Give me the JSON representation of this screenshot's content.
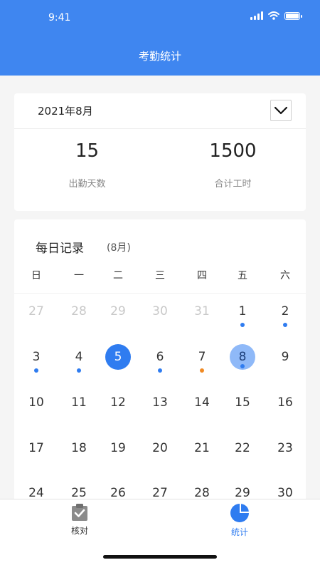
{
  "status": {
    "time": "9:41"
  },
  "nav": {
    "title": "考勤统计"
  },
  "summary": {
    "month": "2021年8月",
    "stats": [
      {
        "value": "15",
        "label": "出勤天数"
      },
      {
        "value": "1500",
        "label": "合计工时"
      }
    ]
  },
  "calendar": {
    "title": "每日记录",
    "subtitle": "(8月)",
    "weekdays": [
      "日",
      "一",
      "二",
      "三",
      "四",
      "五",
      "六"
    ],
    "dot_colors": {
      "blue": "#2f7cf0",
      "orange": "#f08a24"
    },
    "weeks": [
      [
        {
          "day": "27",
          "other": true
        },
        {
          "day": "28",
          "other": true
        },
        {
          "day": "29",
          "other": true
        },
        {
          "day": "30",
          "other": true
        },
        {
          "day": "31",
          "other": true
        },
        {
          "day": "1",
          "dot": "blue"
        },
        {
          "day": "2",
          "dot": "blue"
        }
      ],
      [
        {
          "day": "3",
          "dot": "blue"
        },
        {
          "day": "4",
          "dot": "blue"
        },
        {
          "day": "5",
          "state": "today"
        },
        {
          "day": "6",
          "dot": "blue"
        },
        {
          "day": "7",
          "dot": "orange"
        },
        {
          "day": "8",
          "state": "selected",
          "dot": "blue"
        },
        {
          "day": "9"
        }
      ],
      [
        {
          "day": "10"
        },
        {
          "day": "11"
        },
        {
          "day": "12"
        },
        {
          "day": "13"
        },
        {
          "day": "14"
        },
        {
          "day": "15"
        },
        {
          "day": "16"
        }
      ],
      [
        {
          "day": "17"
        },
        {
          "day": "18"
        },
        {
          "day": "19"
        },
        {
          "day": "20"
        },
        {
          "day": "21"
        },
        {
          "day": "22"
        },
        {
          "day": "23"
        }
      ],
      [
        {
          "day": "24"
        },
        {
          "day": "25"
        },
        {
          "day": "26"
        },
        {
          "day": "27"
        },
        {
          "day": "28"
        },
        {
          "day": "29"
        },
        {
          "day": "30"
        }
      ]
    ]
  },
  "tabbar": {
    "items": [
      {
        "label": "核对",
        "icon": "clipboard-check-icon",
        "active": false
      },
      {
        "label": "统计",
        "icon": "pie-chart-icon",
        "active": true
      }
    ],
    "active_color": "#2f7cf0",
    "inactive_color": "#333333"
  }
}
